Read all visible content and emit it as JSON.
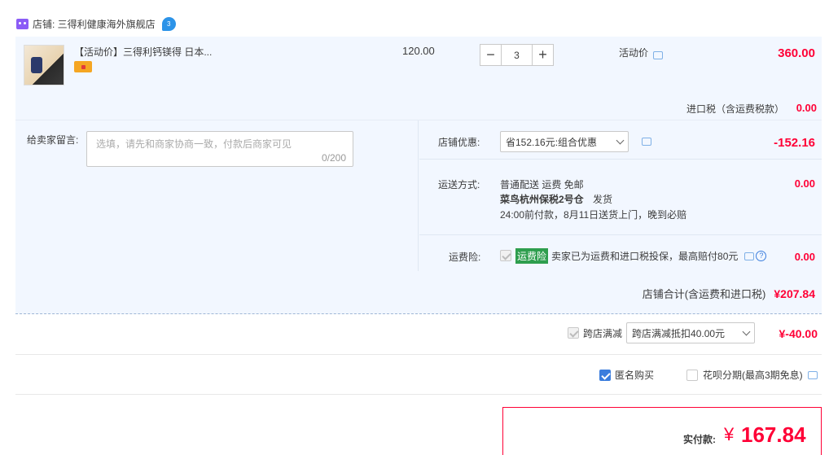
{
  "store": {
    "label": "店铺: 三得利健康海外旗舰店",
    "wang_badge": "3"
  },
  "item": {
    "title": "【活动价】三得利钙镁得 日本...",
    "price": "120.00",
    "quantity": "3",
    "minus": "−",
    "plus": "+",
    "promo_label": "活动价",
    "subtotal": "360.00",
    "tax_label": "进口税（含运费税款）",
    "tax_value": "0.00"
  },
  "message": {
    "label": "给卖家留言:",
    "placeholder": "选填，请先和商家协商一致，付款后商家可见",
    "counter": "0/200"
  },
  "discount": {
    "label": "店铺优惠:",
    "selected": "省152.16元:组合优惠",
    "value": "-152.16"
  },
  "shipping": {
    "label": "运送方式:",
    "line1": "普通配送 运费 免邮",
    "line2": "菜鸟杭州保税2号仓",
    "line2_suffix": "发货",
    "line3": "24:00前付款，8月11日送货上门，晚到必赔",
    "value": "0.00"
  },
  "insurance": {
    "label": "运费险:",
    "badge": "运费险",
    "text": "卖家已为运费和进口税投保，最高赔付80元",
    "value": "0.00"
  },
  "store_total": {
    "label": "店铺合计(含运费和进口税)",
    "value": "¥207.84"
  },
  "cross_store": {
    "label": "跨店满减",
    "selected": "跨店满减抵扣40.00元",
    "value": "¥-40.00"
  },
  "options": {
    "anonymous": "匿名购买",
    "installment": "花呗分期(最高3期免息)"
  },
  "payment": {
    "label": "实付款:",
    "currency": "¥",
    "amount": "167.84"
  },
  "colors": {
    "accent_red": "#ff0036",
    "panel_bg": "#f2f7ff",
    "insurance_green": "#2e9e4e"
  }
}
